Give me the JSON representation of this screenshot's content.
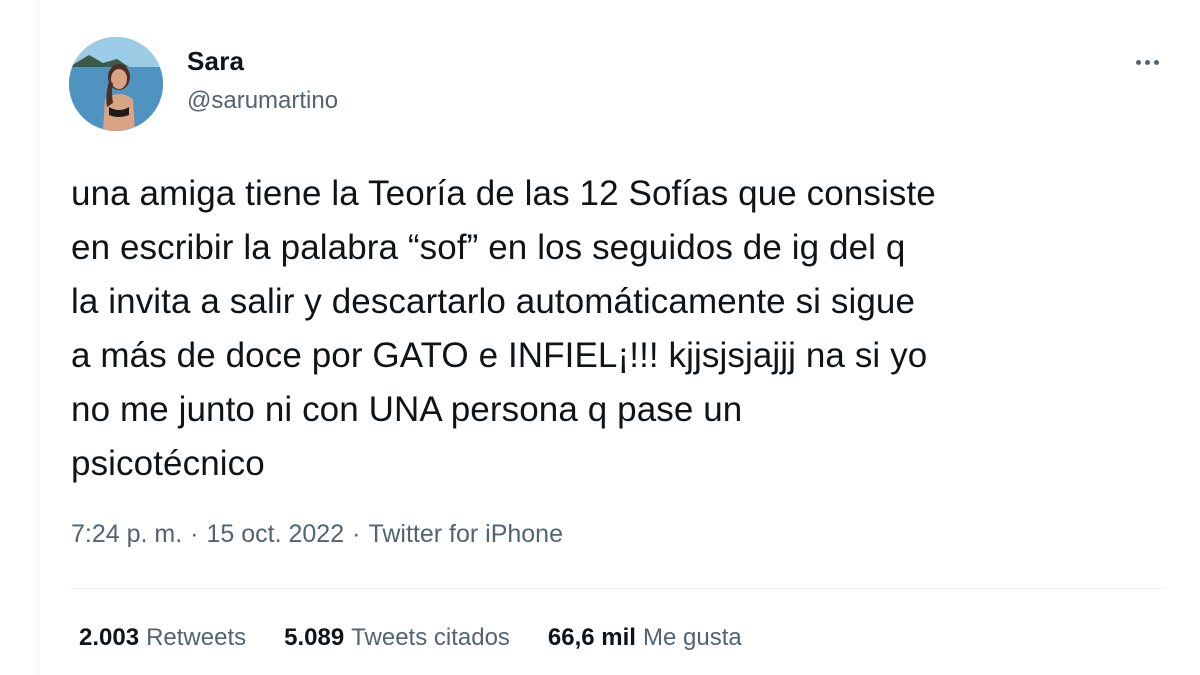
{
  "author": {
    "name": "Sara",
    "handle": "@sarumartino",
    "avatar_icon": "profile-photo"
  },
  "tweet": {
    "text": "una amiga tiene la Teoría de las 12 Sofías que consiste\nen escribir la palabra “sof” en los seguidos de ig del q\nla invita a salir y descartarlo automáticamente si sigue\na más de doce por GATO e INFIEL¡!!! kjjsjsjajjj na si yo\nno me junto ni con UNA persona q pase un\npsicotécnico",
    "time": "7:24 p. m.",
    "separator": "·",
    "date": "15 oct. 2022",
    "source": "Twitter for iPhone"
  },
  "stats": [
    {
      "value": "2.003",
      "label": "Retweets"
    },
    {
      "value": "5.089",
      "label": "Tweets citados"
    },
    {
      "value": "66,6 mil",
      "label": "Me gusta"
    }
  ],
  "colors": {
    "text": "#0f1419",
    "secondary": "#536471",
    "divider": "#eff3f4"
  },
  "icons": {
    "more": "more-horizontal-icon"
  }
}
